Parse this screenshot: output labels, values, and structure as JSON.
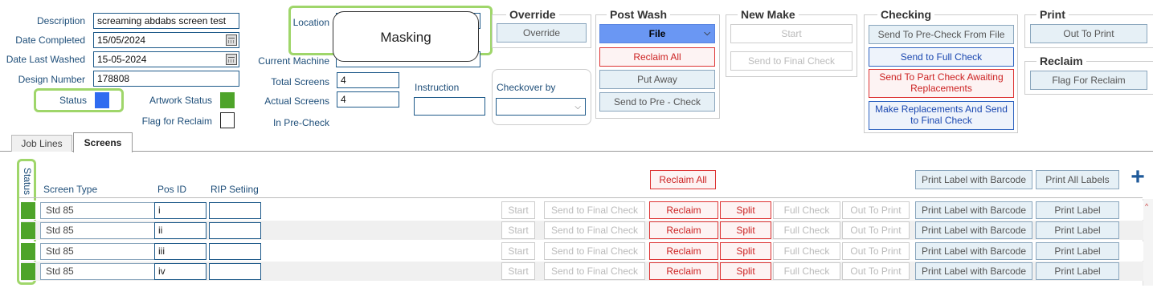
{
  "form": {
    "description_label": "Description",
    "description_value": "screaming abdabs screen test",
    "date_completed_label": "Date Completed",
    "date_completed_value": "15/05/2024",
    "date_last_washed_label": "Date Last Washed",
    "date_last_washed_value": "15-05-2024",
    "design_number_label": "Design Number",
    "design_number_value": "178808",
    "status_label": "Status",
    "artwork_status_label": "Artwork Status",
    "flag_for_reclaim_label": "Flag for Reclaim",
    "location_label": "Location",
    "current_machine_label": "Current Machine",
    "total_screens_label": "Total Screens",
    "total_screens_value": "4",
    "actual_screens_label": "Actual Screens",
    "actual_screens_value": "4",
    "in_precheck_label": "In Pre-Check",
    "instruction_label": "Instruction",
    "checkover_label": "Checkover by"
  },
  "masking_popup": {
    "text": "Masking"
  },
  "groups": {
    "override": {
      "title": "Override",
      "button": "Override"
    },
    "post_wash": {
      "title": "Post Wash",
      "file": "File",
      "reclaim_all": "Reclaim All",
      "put_away": "Put Away",
      "send_pre_check": "Send to Pre - Check"
    },
    "new_make": {
      "title": "New Make",
      "start": "Start",
      "send_final": "Send to Final Check"
    },
    "checking": {
      "title": "Checking",
      "send_precheck_file": "Send To Pre-Check From File",
      "send_full": "Send to Full Check",
      "part_check_1": "Send To Part Check Awaiting",
      "part_check_2": "Replacements",
      "make_repl_1": "Make Replacements And Send",
      "make_repl_2": "to Final Check"
    },
    "print": {
      "title": "Print",
      "out_to_print": "Out To Print"
    },
    "reclaim": {
      "title": "Reclaim",
      "flag": "Flag For Reclaim"
    }
  },
  "tabs": [
    "Job Lines",
    "Screens"
  ],
  "screens": {
    "status_header": "Status",
    "screen_type_header": "Screen Type",
    "pos_id_header": "Pos ID",
    "rip_header": "RIP Setiing",
    "reclaim_all": "Reclaim All",
    "print_label_barcode": "Print Label with Barcode",
    "print_all_labels": "Print All Labels",
    "add_symbol": "+",
    "row_buttons": {
      "start": "Start",
      "send_final": "Send to Final Check",
      "reclaim": "Reclaim",
      "split": "Split",
      "full_check": "Full Check",
      "out_to_print": "Out To Print",
      "print_barcode": "Print Label with Barcode",
      "print_label": "Print Label"
    },
    "rows": [
      {
        "screen_type": "Std 85",
        "pos_id": "i"
      },
      {
        "screen_type": "Std 85",
        "pos_id": "ii"
      },
      {
        "screen_type": "Std 85",
        "pos_id": "iii"
      },
      {
        "screen_type": "Std 85",
        "pos_id": "iv"
      }
    ]
  },
  "colors": {
    "status_blue": "#2f6bf0",
    "status_green": "#4ea42a",
    "highlight": "#9fd66a",
    "accent_red": "#dd3333"
  }
}
